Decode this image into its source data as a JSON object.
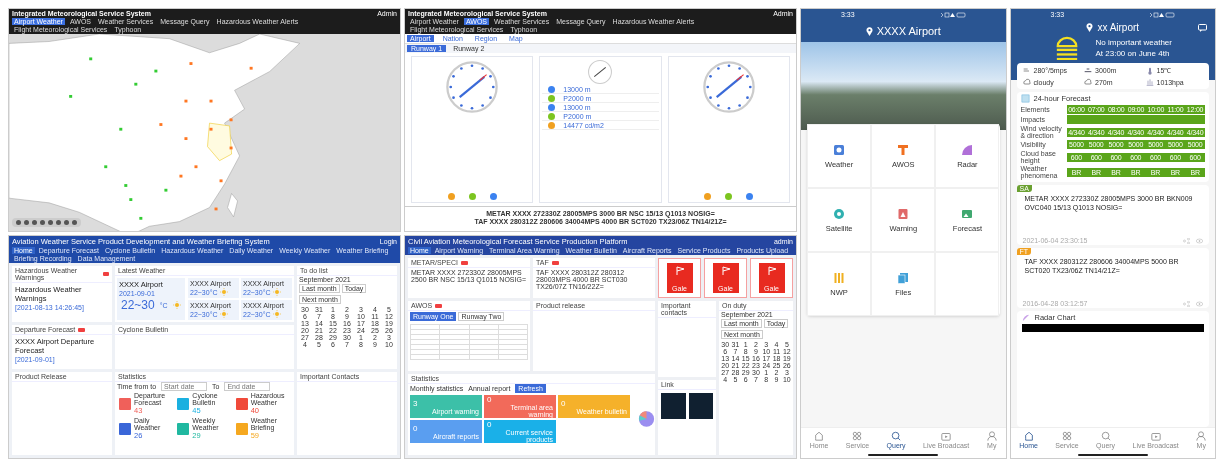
{
  "map_system": {
    "title": "Integrated Meteorological Service System",
    "user": "Admin",
    "tabs": [
      {
        "label": "Airport Weather",
        "selected": true
      },
      {
        "label": "AWOS",
        "selected": false
      },
      {
        "label": "Weather Services",
        "selected": false
      },
      {
        "label": "Message Query",
        "selected": false
      },
      {
        "label": "Hazardous Weather Alerts",
        "selected": false
      },
      {
        "label": "Flight Meteorological Services",
        "selected": false
      },
      {
        "label": "Typhoon",
        "selected": false
      }
    ]
  },
  "awos_system": {
    "title": "Integrated Meteorological Service System",
    "user": "Admin",
    "tabs": [
      {
        "label": "Airport Weather",
        "selected": false
      },
      {
        "label": "AWOS",
        "selected": true
      },
      {
        "label": "Weather Services",
        "selected": false
      },
      {
        "label": "Message Query",
        "selected": false
      },
      {
        "label": "Hazardous Weather Alerts",
        "selected": false
      },
      {
        "label": "Flight Meteorological Services",
        "selected": false
      },
      {
        "label": "Typhoon",
        "selected": false
      }
    ],
    "subtabs": [
      {
        "label": "Airport",
        "selected": true
      },
      {
        "label": "Nation",
        "selected": false
      },
      {
        "label": "Region",
        "selected": false
      },
      {
        "label": "Map",
        "selected": false
      }
    ],
    "runways": [
      {
        "label": "Runway 1",
        "selected": true
      },
      {
        "label": "Runway 2",
        "selected": false
      }
    ],
    "cards": [
      {
        "kind": "dial",
        "indicators": [
          {
            "color": "#f0a020"
          },
          {
            "color": "#7cc520"
          },
          {
            "color": "#3b82f0"
          }
        ]
      },
      {
        "kind": "list",
        "readings": [
          {
            "value": "13000 m",
            "color": "#3b82f0"
          },
          {
            "value": "P2000 m",
            "color": "#7cc520"
          },
          {
            "value": "13000 m",
            "color": "#3b82f0"
          },
          {
            "value": "P2000 m",
            "color": "#7cc520"
          },
          {
            "value": "14477 cd/m2",
            "color": "#f0a020"
          }
        ]
      },
      {
        "kind": "dial",
        "indicators": [
          {
            "color": "#f0a020"
          },
          {
            "color": "#7cc520"
          },
          {
            "color": "#3b82f0"
          }
        ]
      }
    ],
    "reports": [
      "METAR XXXX 272330Z 28005MPS 3000 BR NSC 15/13 Q1013 NOSIG=",
      "TAF XXXX 280312Z 280606 34004MPS 4000 BR SCT020 TX23/06Z TN14/21Z="
    ]
  },
  "briefing_system": {
    "title": "Aviation Weather Service Product Development and Weather Briefing System",
    "user": "Login",
    "nav": [
      {
        "label": "Home",
        "selected": true
      },
      {
        "label": "Departure Forecast",
        "selected": false
      },
      {
        "label": "Cyclone Bulletin",
        "selected": false
      },
      {
        "label": "Hazardous Weather",
        "selected": false
      },
      {
        "label": "Daily Weather",
        "selected": false
      },
      {
        "label": "Weekly Weather",
        "selected": false
      },
      {
        "label": "Weather Briefing",
        "selected": false
      },
      {
        "label": "Briefing Recording",
        "selected": false
      },
      {
        "label": "Data Management",
        "selected": false
      }
    ],
    "warning": {
      "title": "Hazardous Weather Warnings",
      "heading": "Hazardous Weather Warnings",
      "date": "[2021-08-13 14:26:45]"
    },
    "latest": {
      "title": "Latest Weather",
      "airport": "XXXX Airport",
      "date": "2021-09-01",
      "temp": "22~30",
      "unit": "°C",
      "others": [
        {
          "airport": "XXXX Airport",
          "temp": "22~30°C"
        },
        {
          "airport": "XXXX Airport",
          "temp": "22~30°C"
        },
        {
          "airport": "XXXX Airport",
          "temp": "22~30°C"
        },
        {
          "airport": "XXXX Airport",
          "temp": "22~30°C"
        }
      ]
    },
    "todo": {
      "title": "To do list",
      "month": "September 2021",
      "buttons": [
        "Last month",
        "Today",
        "Next month"
      ],
      "days": [
        "30",
        "31",
        "1",
        "2",
        "3",
        "4",
        "5",
        "6",
        "7",
        "8",
        "9",
        "10",
        "11",
        "12",
        "13",
        "14",
        "15",
        "16",
        "17",
        "18",
        "19",
        "20",
        "21",
        "22",
        "23",
        "24",
        "25",
        "26",
        "27",
        "28",
        "29",
        "30",
        "1",
        "2",
        "3",
        "4",
        "5",
        "6",
        "7",
        "8",
        "9",
        "10"
      ]
    },
    "departure": {
      "title": "Departure Forecast",
      "heading": "XXXX Airport Departure Forecast",
      "date": "[2021-09-01]"
    },
    "cyclone": {
      "title": "Cyclone Bulletin"
    },
    "products": {
      "title": "Product Release"
    },
    "stats": {
      "title": "Statistics",
      "filter": "Time from to",
      "start": {
        "placeholder": "Start date"
      },
      "to": "To",
      "end": {
        "placeholder": "End date"
      },
      "tiles": [
        {
          "label": "Departure Forecast",
          "count": "43",
          "color": "#f0605a"
        },
        {
          "label": "Cyclone Bulletin",
          "count": "45",
          "color": "#1ab0e0"
        },
        {
          "label": "Hazardous Weather",
          "count": "40",
          "color": "#f04a3a"
        },
        {
          "label": "Daily Weather",
          "count": "26",
          "color": "#3a66d8"
        },
        {
          "label": "Weekly Weather",
          "count": "29",
          "color": "#20b8a0"
        },
        {
          "label": "Weather Briefing",
          "count": "59",
          "color": "#f5a820"
        }
      ]
    },
    "contacts": {
      "title": "Important Contacts"
    }
  },
  "platform": {
    "title": "Civil Aviation Meteorological Forecast Service Production Platform",
    "user": "admin",
    "nav": [
      {
        "label": "Home",
        "selected": true
      },
      {
        "label": "Airport Warning",
        "selected": false
      },
      {
        "label": "Terminal Area Warning",
        "selected": false
      },
      {
        "label": "Weather Bulletin",
        "selected": false
      },
      {
        "label": "Aircraft Reports",
        "selected": false
      },
      {
        "label": "Service Products",
        "selected": false
      },
      {
        "label": "Products Upload",
        "selected": false
      }
    ],
    "metar": {
      "title": "METAR/SPECI",
      "text": "METAR XXXX 272330Z 28005MPS 2500 BR NSC 15/13 Q1015 NOSIG="
    },
    "taf": {
      "title": "TAF",
      "text": "TAF XXXX 280312Z 280312 28003MPS 4000 BR SCT030 TX26/07Z TN16/22Z="
    },
    "alerts": [
      {
        "label": "Gale"
      },
      {
        "label": "Gale"
      },
      {
        "label": "Gale"
      }
    ],
    "awos": {
      "title": "AWOS",
      "tabs": [
        {
          "label": "Runway One",
          "selected": true
        },
        {
          "label": "Runway Two",
          "selected": false
        }
      ]
    },
    "release": {
      "title": "Product release"
    },
    "contacts": {
      "title": "Important contacts"
    },
    "duty": {
      "title": "On duty",
      "month": "September 2021",
      "buttons": [
        "Last month",
        "Today",
        "Next month"
      ],
      "days": [
        "30",
        "31",
        "1",
        "2",
        "3",
        "4",
        "5",
        "6",
        "7",
        "8",
        "9",
        "10",
        "11",
        "12",
        "13",
        "14",
        "15",
        "16",
        "17",
        "18",
        "19",
        "20",
        "21",
        "22",
        "23",
        "24",
        "25",
        "26",
        "27",
        "28",
        "29",
        "30",
        "1",
        "2",
        "3",
        "4",
        "5",
        "6",
        "7",
        "8",
        "9",
        "10"
      ]
    },
    "stats": {
      "title": "Statistics",
      "refresh": "Refresh",
      "monthly": "Monthly statistics",
      "annual": "Annual report",
      "tiles": [
        {
          "count": "3",
          "label": "Airport warning",
          "color": "#3cc0a8"
        },
        {
          "count": "0",
          "label": "Terminal area warning",
          "color": "#f26a5a"
        },
        {
          "count": "0",
          "label": "Weather bulletin",
          "color": "#f5b12a"
        },
        {
          "count": "0",
          "label": "Aircraft reports",
          "color": "#5a9ef0"
        },
        {
          "count": "0",
          "label": "Current service products",
          "color": "#1ab0e8"
        }
      ]
    },
    "link": {
      "title": "Link"
    }
  },
  "app_home": {
    "time": "3:33",
    "title": "XXXX Airport",
    "services": [
      {
        "label": "Weather",
        "color": "#4a7fd8"
      },
      {
        "label": "AWOS",
        "color": "#f07020"
      },
      {
        "label": "Radar",
        "color": "#b070d8"
      },
      {
        "label": "Satellite",
        "color": "#30b0b0"
      },
      {
        "label": "Warning",
        "color": "#e06a6a"
      },
      {
        "label": "Forecast",
        "color": "#40a870"
      },
      {
        "label": "NWP",
        "color": "#f0b020"
      },
      {
        "label": "Files",
        "color": "#40a0d8"
      }
    ],
    "tabs": [
      {
        "label": "Home",
        "selected": false
      },
      {
        "label": "Service",
        "selected": false
      },
      {
        "label": "Query",
        "selected": true
      },
      {
        "label": "Live Broadcast",
        "selected": false
      },
      {
        "label": "My",
        "selected": false
      }
    ]
  },
  "app_weather": {
    "time": "3:33",
    "title": "xx Airport",
    "summary": "No important weather",
    "at": "At 23:00 on June 4th",
    "conditions": [
      "280°/5mps",
      "3000m",
      "15℃",
      "cloudy",
      "270m",
      "1013hpa"
    ],
    "forecast": {
      "title": "24-hour Forecast",
      "rows": [
        {
          "label": "Elements",
          "cells": [
            "06:00",
            "07:00",
            "08:00",
            "09:00",
            "10:00",
            "11:00",
            "12:00"
          ]
        },
        {
          "label": "Impacts",
          "cells": []
        },
        {
          "label": "Wind velocity & direction",
          "cells": [
            "4/340",
            "4/340",
            "4/340",
            "4/340",
            "4/340",
            "4/340",
            "4/340"
          ]
        },
        {
          "label": "Visibility",
          "cells": [
            "5000",
            "5000",
            "5000",
            "5000",
            "5000",
            "5000",
            "5000"
          ]
        },
        {
          "label": "Cloud base height",
          "cells": [
            "600",
            "600",
            "600",
            "600",
            "600",
            "600",
            "600"
          ]
        },
        {
          "label": "Weather phenomena",
          "cells": [
            "BR",
            "BR",
            "BR",
            "BR",
            "BR",
            "BR",
            "BR"
          ]
        }
      ]
    },
    "reports": [
      {
        "badge": "SA",
        "color": "#6aa030",
        "text": "METAR XXXX 272330Z 28005MPS 3000 BR BKN009 OVC040 15/13 Q1013 NOSIG=",
        "time": "2021-06-04 23:30:15"
      },
      {
        "badge": "FT",
        "color": "#f0a020",
        "text": "TAF XXXX 280312Z 280606 34004MPS 5000 BR SCT020 TX23/06Z TN14/21Z=",
        "time": "2016-04-28 03:12:57"
      }
    ],
    "radar": "Radar Chart",
    "tabs": [
      {
        "label": "Home",
        "selected": true
      },
      {
        "label": "Service",
        "selected": false
      },
      {
        "label": "Query",
        "selected": false
      },
      {
        "label": "Live Broadcast",
        "selected": false
      },
      {
        "label": "My",
        "selected": false
      }
    ]
  }
}
